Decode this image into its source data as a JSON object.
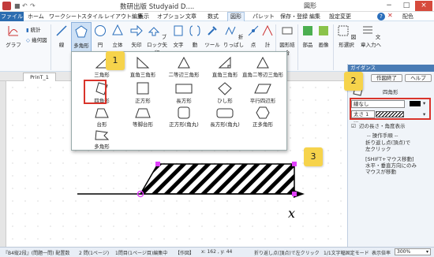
{
  "titlebar": {
    "window_title": "数研出版 Studyaid D....",
    "context_title": "図形",
    "minimize": "−",
    "maximize": "□",
    "close": "×"
  },
  "menu": {
    "file": "ファイル",
    "tabs": [
      "ホーム",
      "ワークシート",
      "スタイル",
      "レイアウト編集",
      "表示",
      "オプション",
      "文章",
      "数式",
      "図形",
      "パレット",
      "保存・登録",
      "編集",
      "設定変更"
    ],
    "active_tab": "図形",
    "hyperlink": "配色"
  },
  "ribbon": {
    "graph": "グラフ",
    "stats": "統計",
    "geometry": "幾何図",
    "line": "線",
    "polygon": "多角形",
    "circle": "円",
    "solid": "立体",
    "arrow": "矢印",
    "block_arrow": "ブロック矢印",
    "stamp": "文字",
    "brace": "括弧",
    "dynamic": "動",
    "tool": "ツール",
    "fold": "折りっぱし",
    "pointer": "点",
    "measure": "計",
    "clip": "図形",
    "compose": "図形結合",
    "parts": "部品",
    "image": "画像",
    "shape_select": "図形選択",
    "text_insert": "文章入力へ",
    "group_edit": "編集"
  },
  "popup": {
    "shapes": [
      "三角形",
      "直角三角形",
      "二等辺三角形",
      "直角三角形",
      "直角二等辺三角形",
      "四角形",
      "正方形",
      "長方形",
      "ひし形",
      "平行四辺形",
      "台形",
      "等脚台形",
      "正方形(角丸)",
      "長方形(角丸)",
      "正多角形",
      "多角形"
    ],
    "selected": "四角形"
  },
  "doc": {
    "tab": "PrinT_1",
    "axis_label": "x"
  },
  "guidance": {
    "header": "ガイダンス",
    "finish_button": "作図終了",
    "help_button": "ヘルプ",
    "title": "四角形",
    "line_style": "線なし",
    "thickness": "太さ 1 ...",
    "checkbox_label": "辺の長さ・角度表示",
    "procedure_header": "-- 操作手順 --",
    "steps": [
      "折り返し点(頂点)で",
      "左クリック",
      "",
      "[SHIFT+マウス移動]",
      "水平・垂直方向にのみ",
      "マウスが移動"
    ]
  },
  "callouts": [
    "1",
    "2",
    "3"
  ],
  "status": {
    "left": "『B4縦2段』(問題一問) 配置数",
    "pages": "2 問(1ページ)",
    "editing": "1問目(1ページ目)編集中",
    "label": "【作図】",
    "coords": "x: 162 , y: 44",
    "hint": "折り返し点(頂点)で左クリック",
    "mode": "1/1文字幅固定モード",
    "zoom_label": "表示倍率",
    "zoom": "300%"
  },
  "colors": {
    "accent": "#2b6cb0",
    "highlight": "#d9342b",
    "callout": "#f6d34b",
    "handle": "#e040fb"
  }
}
